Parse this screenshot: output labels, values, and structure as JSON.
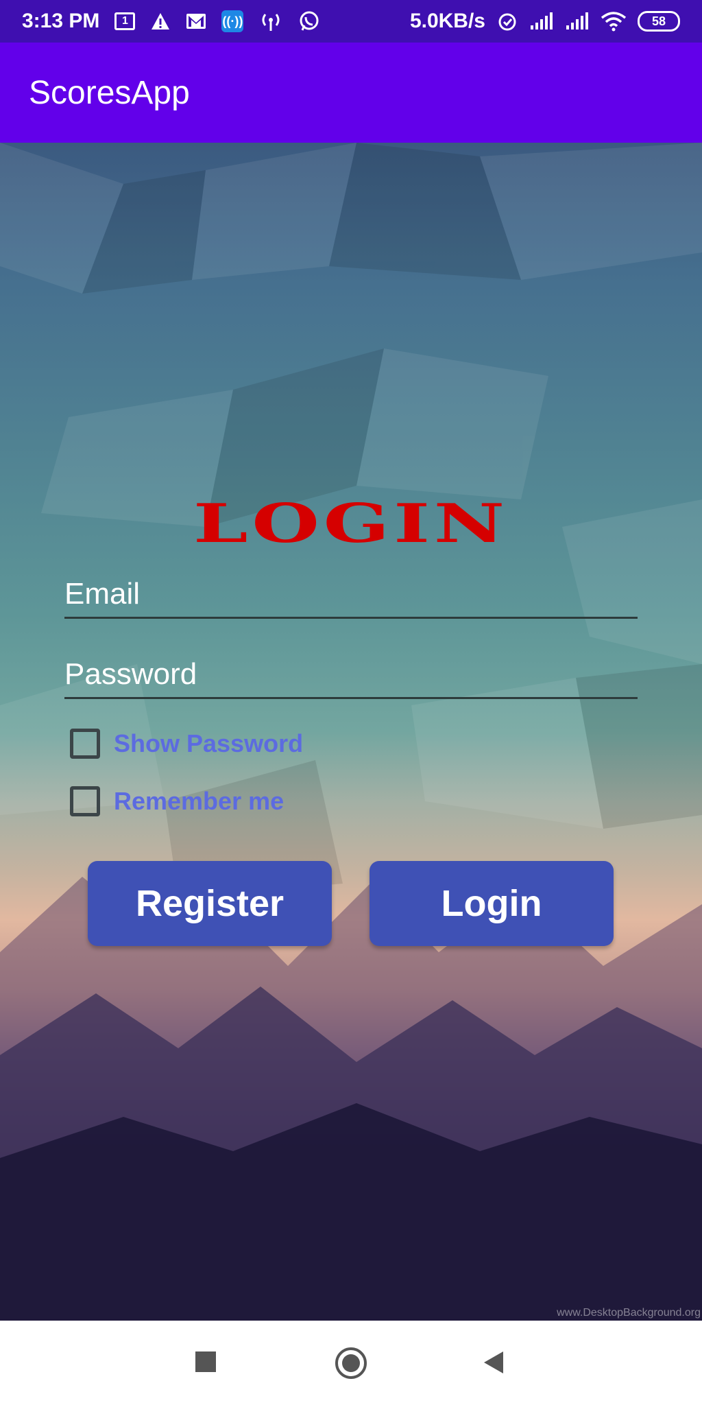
{
  "status_bar": {
    "time": "3:13 PM",
    "notif_box_text": "1",
    "speed": "5.0KB/s",
    "battery": "58",
    "icons": [
      "sim-icon",
      "warning-icon",
      "gmail-icon",
      "hotspot-icon",
      "wifi-calling-icon",
      "whatsapp-icon",
      "alarm-icon",
      "signal-icon",
      "signal-icon",
      "wifi-icon",
      "battery-icon"
    ]
  },
  "app_bar": {
    "title": "ScoresApp"
  },
  "login": {
    "heading": "LOGIN",
    "email_placeholder": "Email",
    "password_placeholder": "Password",
    "show_password_label": "Show Password",
    "remember_me_label": "Remember me",
    "register_button": "Register",
    "login_button": "Login"
  },
  "background": {
    "watermark": "www.DesktopBackground.org"
  },
  "nav_bar": {
    "icons": [
      "recents-square-icon",
      "home-circle-icon",
      "back-triangle-icon"
    ]
  },
  "colors": {
    "status_bar": "#3f0fb0",
    "app_bar": "#6200ea",
    "heading": "#d50000",
    "button": "#3f51b5",
    "checkbox_label": "#5c6be0"
  }
}
